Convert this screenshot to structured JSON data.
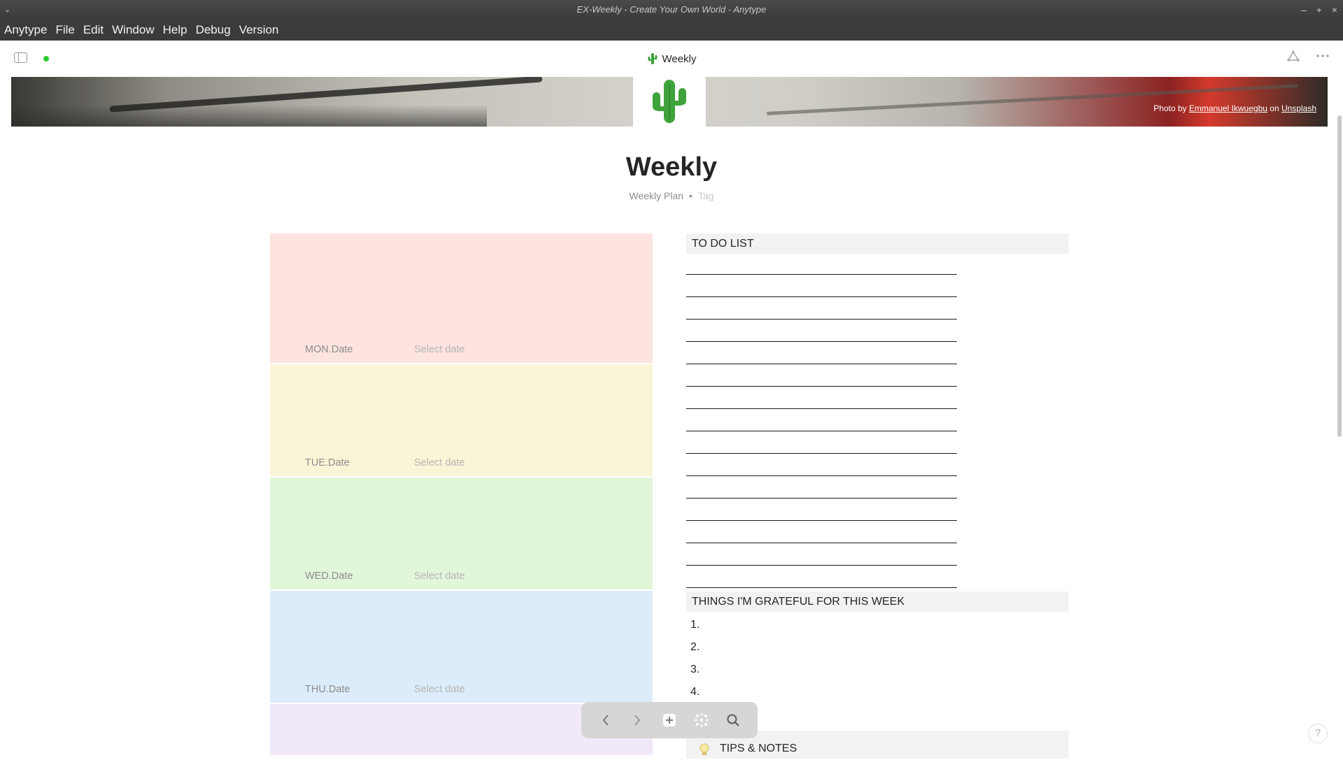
{
  "window": {
    "title": "EX-Weekly - Create Your Own World - Anytype",
    "controls": [
      "–",
      "+",
      "×"
    ]
  },
  "menu": [
    "Anytype",
    "File",
    "Edit",
    "Window",
    "Help",
    "Debug",
    "Version"
  ],
  "header": {
    "title": "Weekly",
    "icon": "cactus-icon"
  },
  "cover": {
    "credit_prefix": "Photo by",
    "credit_author": "Emmanuel Ikwuegbu",
    "credit_on": "on",
    "credit_source": "Unsplash"
  },
  "page": {
    "title": "Weekly",
    "type": "Weekly Plan",
    "tag_placeholder": "Tag"
  },
  "days": [
    {
      "label": "MON.Date",
      "value": "Select date",
      "color": "#fde4df"
    },
    {
      "label": "TUE.Date",
      "value": "Select date",
      "color": "#fbf5d7"
    },
    {
      "label": "WED.Date",
      "value": "Select date",
      "color": "#e2f6da"
    },
    {
      "label": "THU.Date",
      "value": "Select date",
      "color": "#dcecfa"
    },
    {
      "label": "",
      "value": "",
      "color": "#f1e8fa"
    }
  ],
  "todo": {
    "heading": "TO DO LIST",
    "line_count": 15
  },
  "grateful": {
    "heading": "THINGS I'M GRATEFUL FOR THIS WEEK",
    "items": [
      "1.",
      "2.",
      "3.",
      "4."
    ]
  },
  "tips": {
    "heading": "TIPS & NOTES",
    "icon": "lightbulb-icon"
  },
  "help": "?"
}
